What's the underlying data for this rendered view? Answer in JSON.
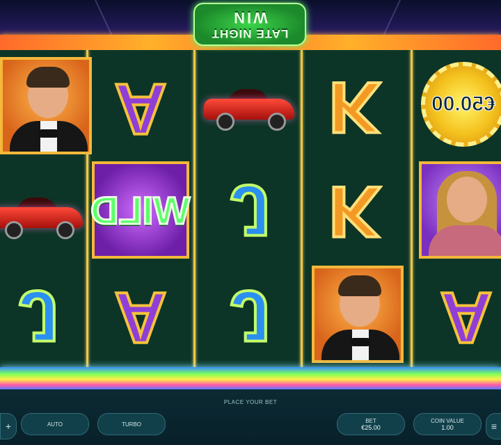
{
  "game": {
    "logo_line1": "LATE NIGHT",
    "logo_line2": "WIN"
  },
  "reels": [
    [
      "man",
      "car",
      "letter-j"
    ],
    [
      "letter-a",
      "wild",
      "letter-a"
    ],
    [
      "car",
      "letter-j",
      "letter-j"
    ],
    [
      "letter-k",
      "letter-k",
      "man"
    ],
    [
      "chip",
      "woman",
      "letter-a"
    ]
  ],
  "symbols": {
    "letter_a": "A",
    "letter_k": "K",
    "letter_j": "J",
    "wild_label": "WILD",
    "chip_value": "€50.00"
  },
  "controls": {
    "place_bet_text": "PLACE YOUR BET",
    "auto_label": "AUTO",
    "turbo_label": "TURBO",
    "bet_label": "BET",
    "bet_value": "€25.00",
    "coin_value_label": "COIN VALUE",
    "coin_value": "1.00",
    "left_edge_icon": "plus-icon",
    "right_edge_icon": "menu-icon"
  },
  "colors": {
    "top_frame": "#ffb02a",
    "reel_bg": "#0c3527",
    "divider": "#f4c640",
    "wild_text": "#5cff6a"
  }
}
